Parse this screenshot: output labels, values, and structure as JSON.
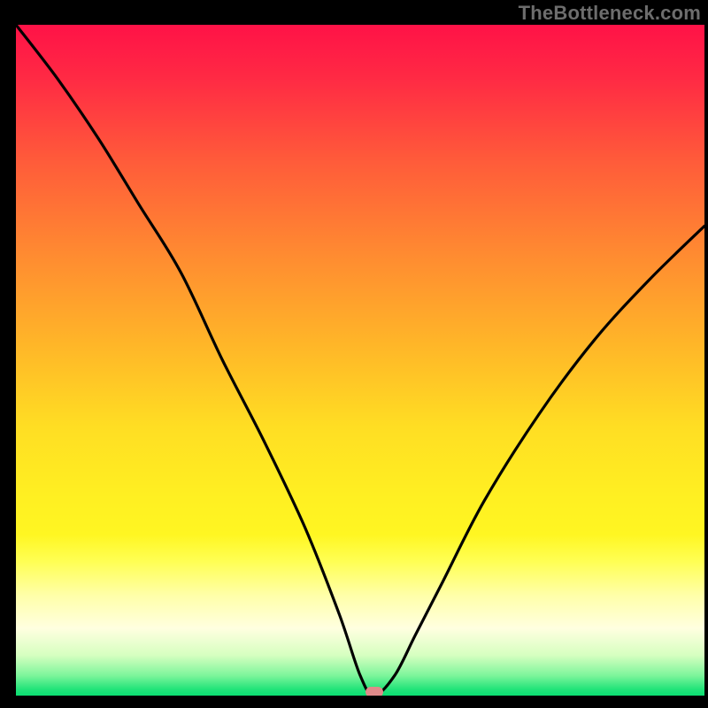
{
  "watermark": "TheBottleneck.com",
  "colors": {
    "curve_stroke": "#000000",
    "marker_fill": "#e08a8a",
    "frame": "#000000"
  },
  "chart_data": {
    "type": "line",
    "title": "",
    "xlabel": "",
    "ylabel": "",
    "xlim": [
      0,
      100
    ],
    "ylim": [
      0,
      100
    ],
    "marker": {
      "x": 52,
      "y": 0
    },
    "series": [
      {
        "name": "bottleneck-curve",
        "x": [
          0,
          6,
          12,
          18,
          24,
          30,
          36,
          42,
          47,
          50,
          52,
          55,
          58,
          62,
          68,
          76,
          84,
          92,
          100
        ],
        "values": [
          100,
          92,
          83,
          73,
          63,
          50,
          38,
          25,
          12,
          3,
          0,
          3,
          9,
          17,
          29,
          42,
          53,
          62,
          70
        ]
      }
    ]
  }
}
